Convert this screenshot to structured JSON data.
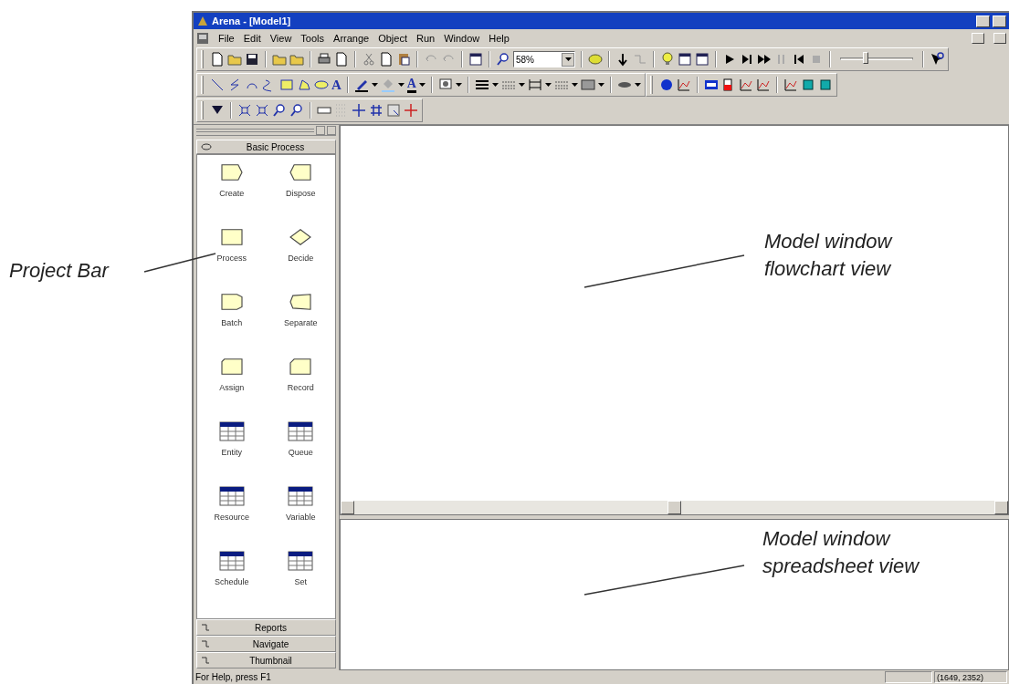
{
  "callouts": {
    "project_bar": "Project Bar",
    "flowchart": [
      "Model window",
      "flowchart view"
    ],
    "spreadsheet": [
      "Model window",
      "spreadsheet view"
    ]
  },
  "window": {
    "title": "Arena - [Model1]"
  },
  "menu": [
    "File",
    "Edit",
    "View",
    "Tools",
    "Arrange",
    "Object",
    "Run",
    "Window",
    "Help"
  ],
  "toolbar": {
    "zoom": "58%",
    "text_tool": "A",
    "font_color_tool": "A",
    "speed_slider": {
      "level": 0.35
    }
  },
  "project_bar": {
    "panel": "Basic Process",
    "modules": [
      {
        "label": "Create",
        "kind": "module"
      },
      {
        "label": "Dispose",
        "kind": "module"
      },
      {
        "label": "Process",
        "kind": "module"
      },
      {
        "label": "Decide",
        "kind": "module"
      },
      {
        "label": "Batch",
        "kind": "module"
      },
      {
        "label": "Separate",
        "kind": "module"
      },
      {
        "label": "Assign",
        "kind": "module"
      },
      {
        "label": "Record",
        "kind": "module"
      },
      {
        "label": "Entity",
        "kind": "data"
      },
      {
        "label": "Queue",
        "kind": "data"
      },
      {
        "label": "Resource",
        "kind": "data"
      },
      {
        "label": "Variable",
        "kind": "data"
      },
      {
        "label": "Schedule",
        "kind": "data"
      },
      {
        "label": "Set",
        "kind": "data"
      }
    ],
    "other_panels": [
      "Reports",
      "Navigate",
      "Thumbnail"
    ]
  },
  "status_bar": {
    "help": "For Help, press F1",
    "coordinates": "(1649, 2352)"
  }
}
